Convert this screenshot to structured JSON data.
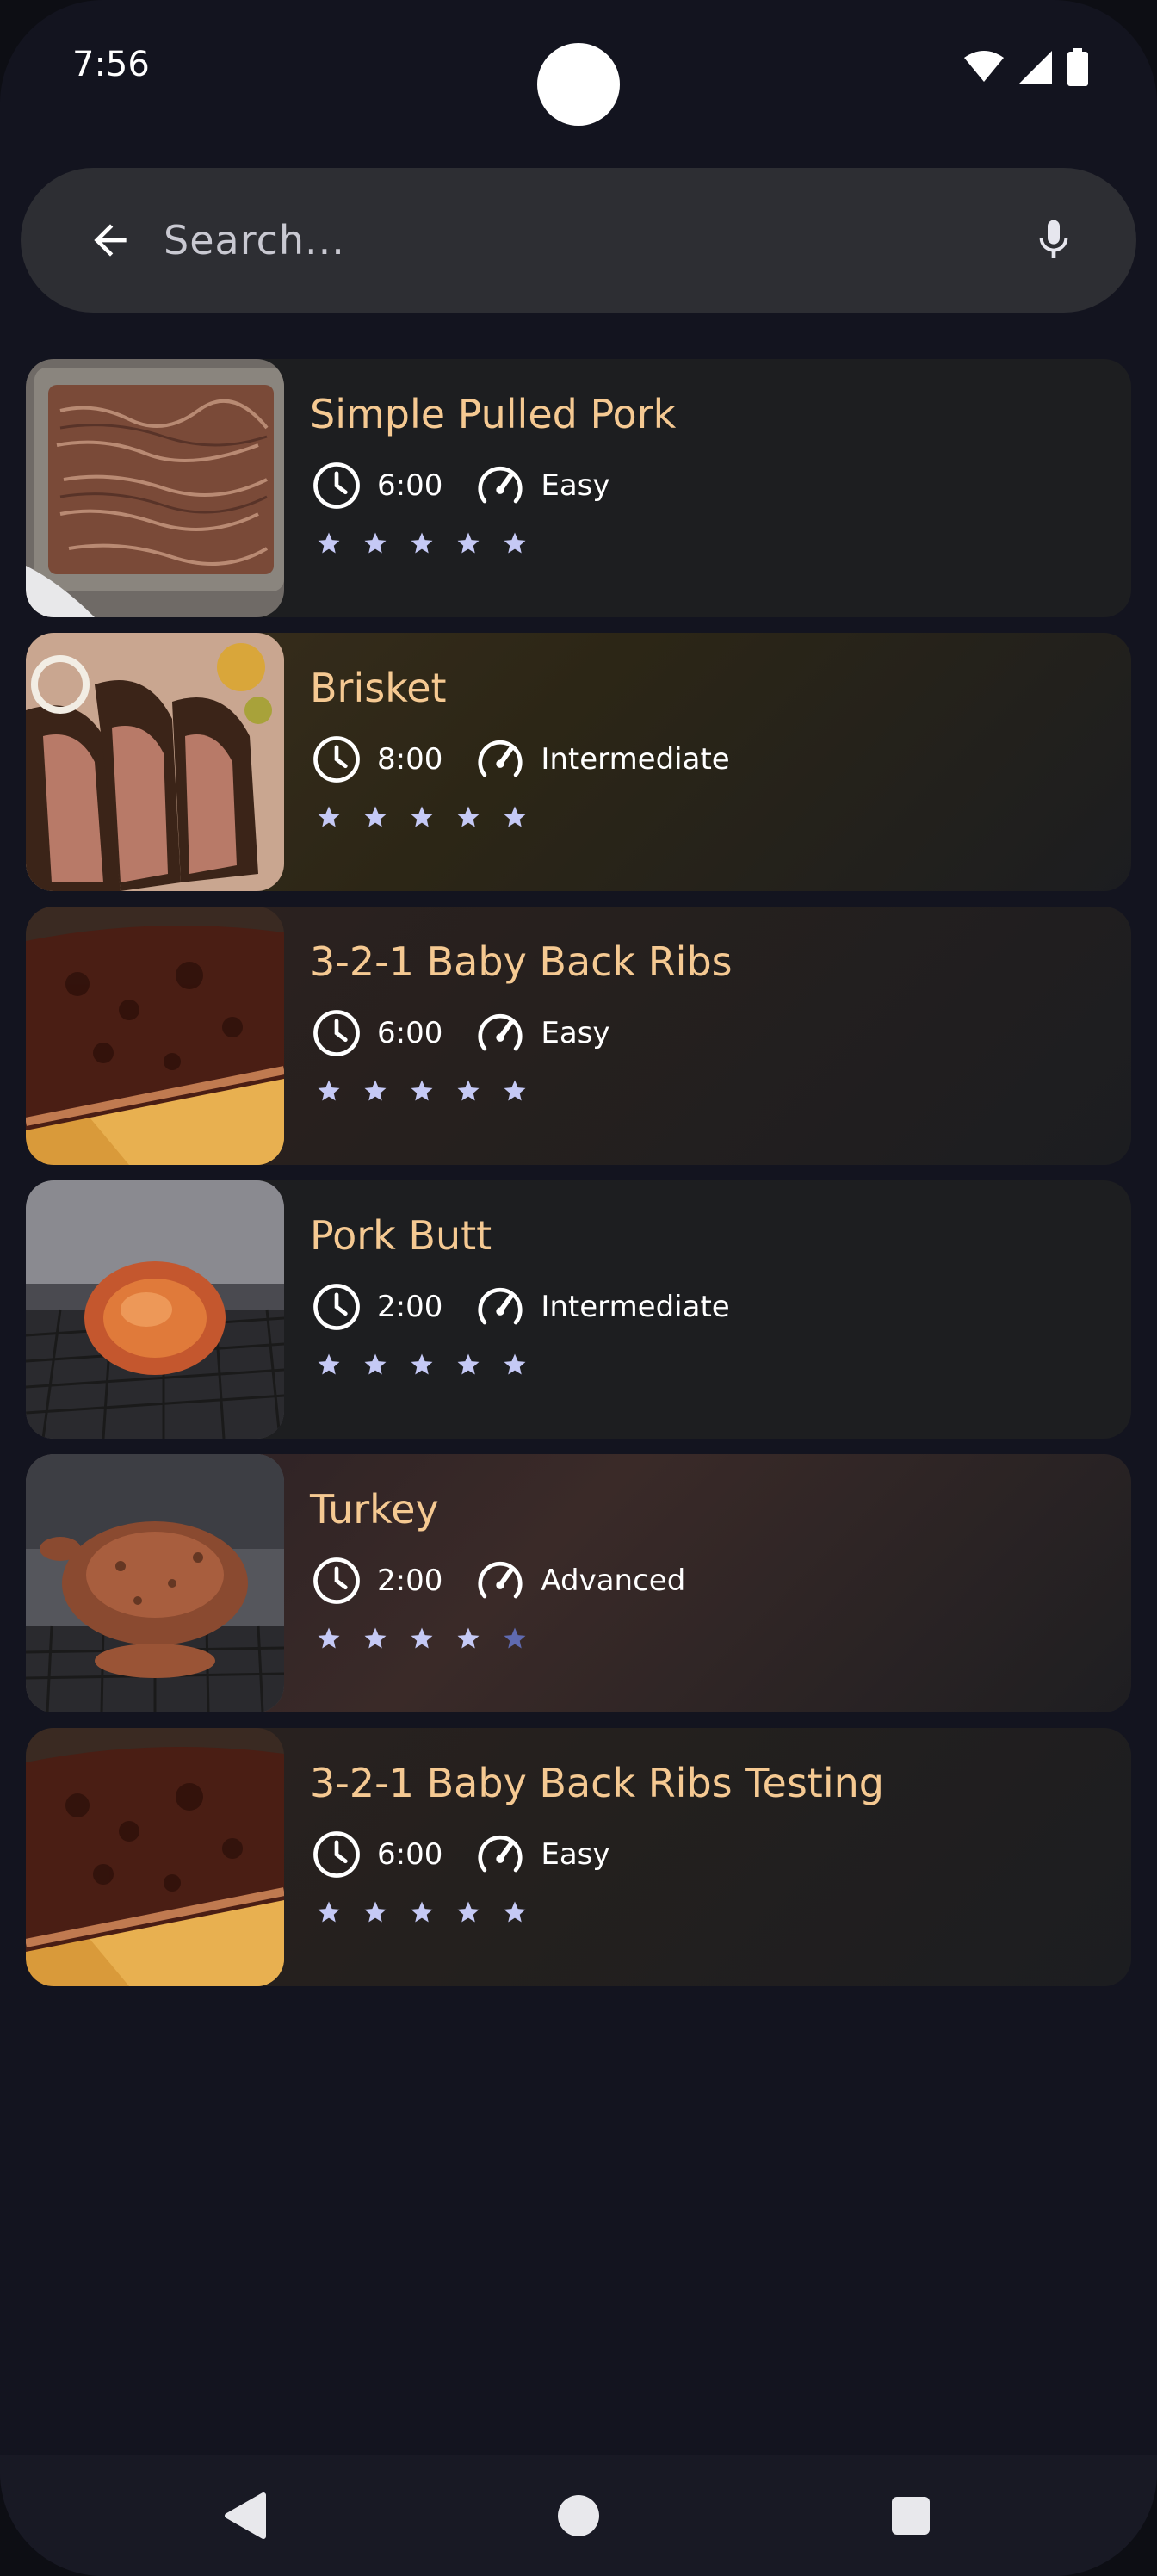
{
  "status_bar": {
    "time": "7:56"
  },
  "search": {
    "placeholder": "Search...",
    "value": ""
  },
  "recipes": [
    {
      "title": "Simple Pulled Pork",
      "time": "6:00",
      "difficulty": "Easy",
      "rating": 5,
      "image": "pulled-pork-photo"
    },
    {
      "title": "Brisket",
      "time": "8:00",
      "difficulty": "Intermediate",
      "rating": 5,
      "image": "brisket-photo"
    },
    {
      "title": "3-2-1 Baby Back Ribs",
      "time": "6:00",
      "difficulty": "Easy",
      "rating": 5,
      "image": "ribs-photo"
    },
    {
      "title": "Pork Butt",
      "time": "2:00",
      "difficulty": "Intermediate",
      "rating": 5,
      "image": "pork-butt-photo"
    },
    {
      "title": "Turkey",
      "time": "2:00",
      "difficulty": "Advanced",
      "rating": 4,
      "image": "turkey-photo"
    },
    {
      "title": "3-2-1 Baby Back Ribs Testing",
      "time": "6:00",
      "difficulty": "Easy",
      "rating": 5,
      "image": "ribs-photo"
    }
  ],
  "icons": {
    "back": "arrow-left-icon",
    "mic": "mic-icon",
    "time": "clock-icon",
    "difficulty": "speedometer-icon",
    "rating": "star-icon"
  },
  "colors": {
    "title": "#f5c992",
    "star_filled": "#c5c9f5",
    "star_empty": "#5f6ab0",
    "card": "#1e1f21",
    "background": "#13141f"
  }
}
